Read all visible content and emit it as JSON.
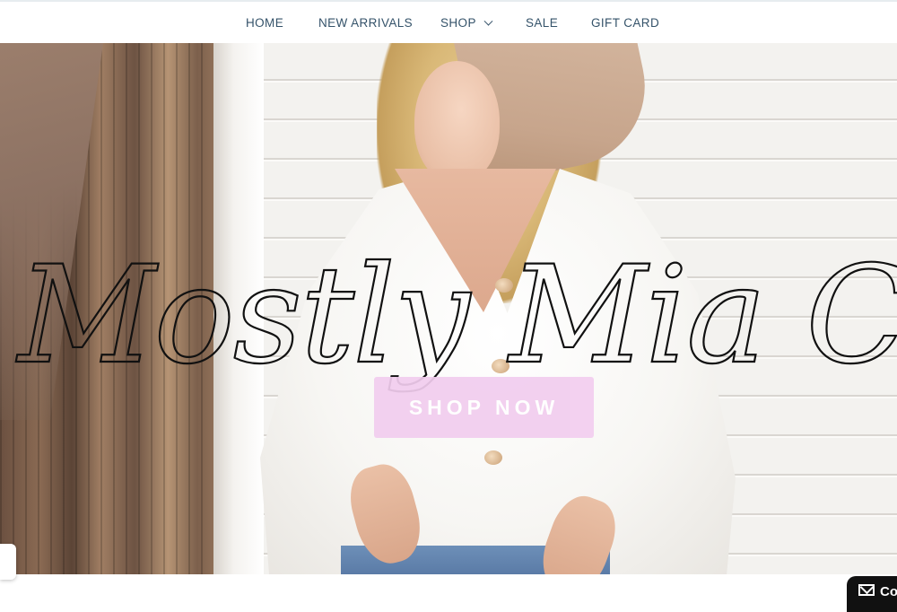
{
  "nav": {
    "items": [
      {
        "label": "HOME"
      },
      {
        "label": "NEW ARRIVALS"
      },
      {
        "label": "SHOP",
        "has_dropdown": true
      },
      {
        "label": "SALE"
      },
      {
        "label": "GIFT CARD"
      }
    ]
  },
  "hero": {
    "title": "Mostly Mia Collectio",
    "cta_label": "SHOP NOW"
  },
  "contact": {
    "label": "Co",
    "icon": "envelope-icon"
  },
  "colors": {
    "nav_text": "#35536a",
    "cta_background": "#f2cdef",
    "cta_text": "#ffffff",
    "title_ink": "#111111"
  }
}
